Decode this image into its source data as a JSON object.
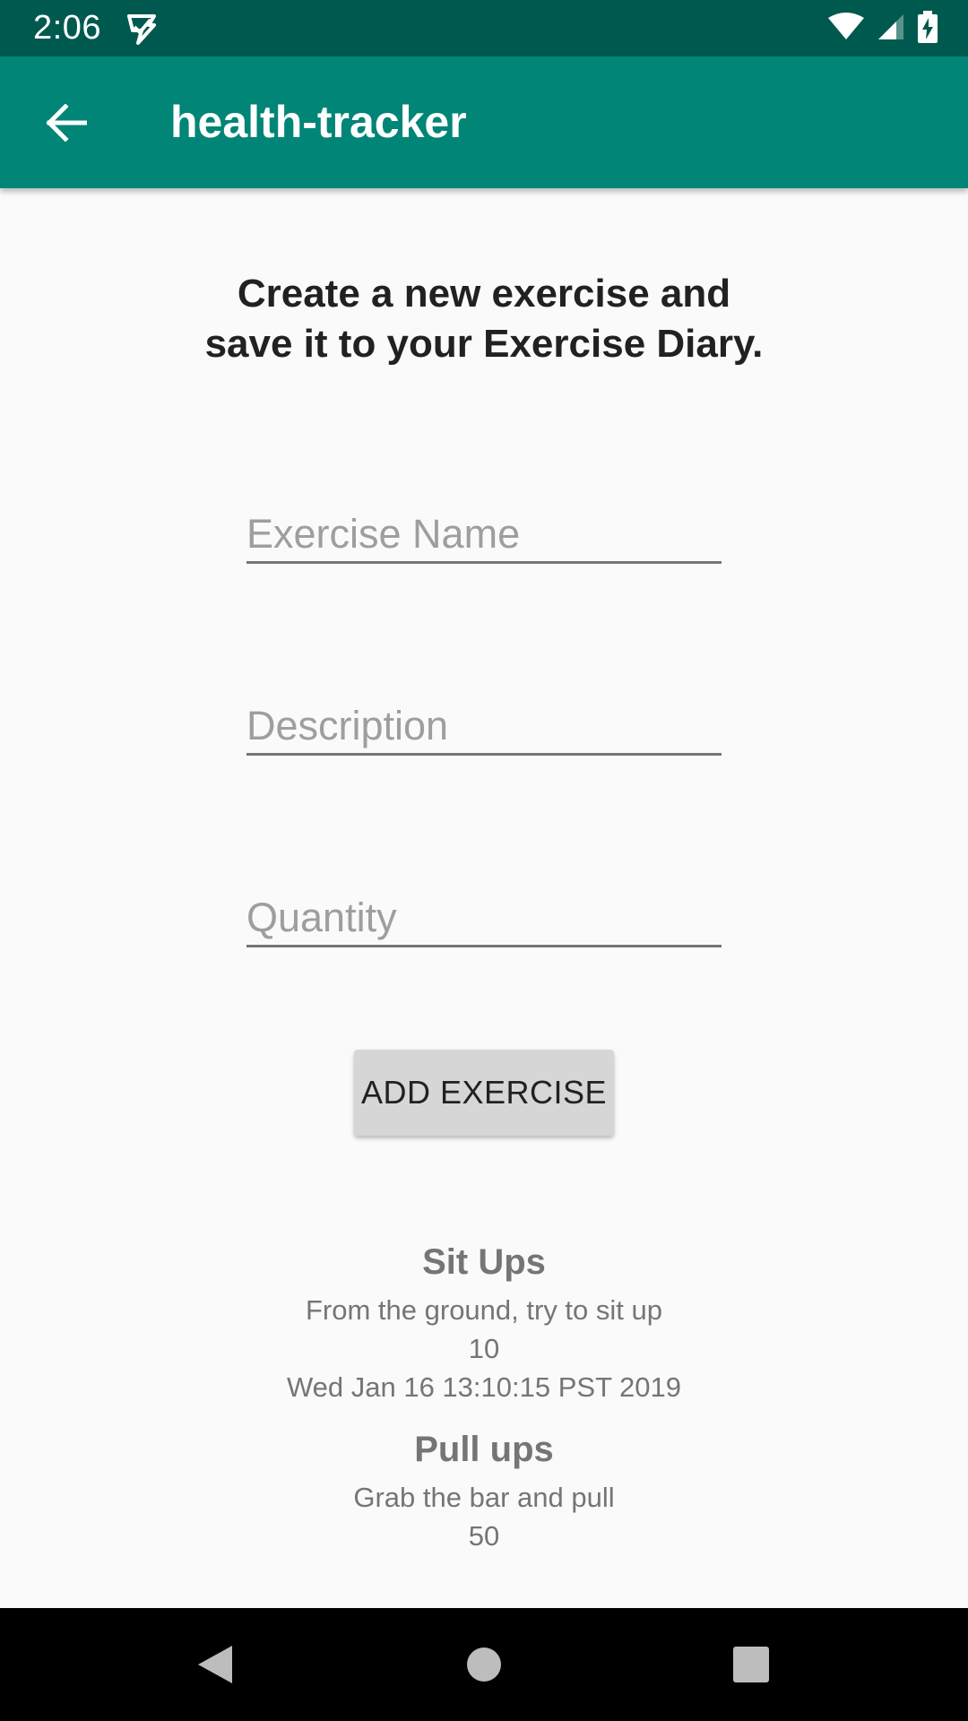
{
  "status_bar": {
    "time": "2:06",
    "icons": [
      "notification-app-icon",
      "wifi-icon",
      "cell-signal-icon",
      "battery-charging-icon"
    ]
  },
  "app_bar": {
    "title": "health-tracker",
    "back_icon": "arrow-back-icon",
    "color": "#008577",
    "status_color": "#00594f"
  },
  "intro": {
    "line1": "Create a new exercise and",
    "line2": "save it to your Exercise Diary."
  },
  "form": {
    "name_placeholder": "Exercise Name",
    "description_placeholder": "Description",
    "quantity_placeholder": "Quantity",
    "submit_label": "ADD EXERCISE"
  },
  "exercises": [
    {
      "title": "Sit Ups",
      "description": "From the ground, try to sit up",
      "quantity": "10",
      "timestamp": "Wed Jan 16 13:10:15 PST 2019"
    },
    {
      "title": "Pull ups",
      "description": "Grab the bar and pull",
      "quantity": "50"
    }
  ],
  "nav_bar": {
    "icons": [
      "back-triangle-icon",
      "home-circle-icon",
      "recents-square-icon"
    ]
  }
}
